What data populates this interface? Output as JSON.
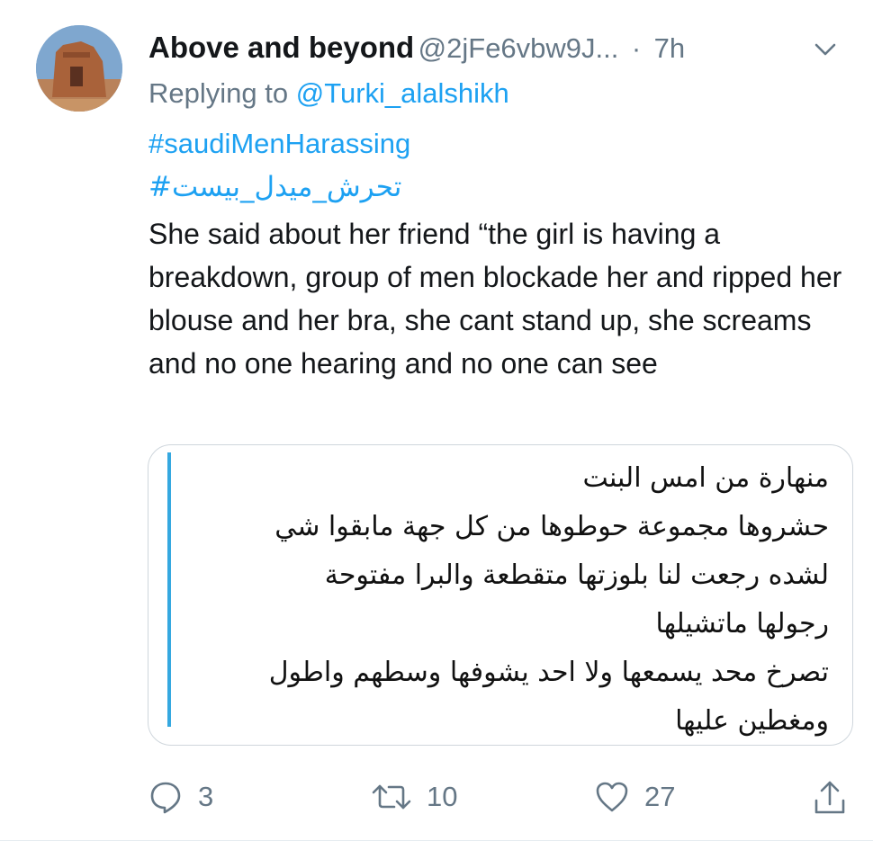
{
  "tweet": {
    "author_name": "Above and beyond",
    "author_handle": "@2jFe6vbw9J...",
    "separator": "·",
    "time": "7h",
    "replying_prefix": "Replying to",
    "replying_to": "@Turki_alalshikh",
    "hashtags": [
      "#saudiMenHarassing",
      "#تحرش_ميدل_بيست"
    ],
    "text": "She said about her friend “the girl is having a breakdown, group of men blockade her and ripped her blouse and her bra, she cant stand up, she screams and no one hearing and no one can see"
  },
  "quoted_image": {
    "lines": [
      "منهارة من امس البنت",
      "حشروها مجموعة حوطوها من كل جهة مابقوا شي",
      "لشده رجعت لنا بلوزتها متقطعة والبرا مفتوحة",
      "رجولها ماتشيلها",
      "تصرخ محد يسمعها ولا احد يشوفها وسطهم واطول",
      "ومغطين عليها"
    ]
  },
  "actions": {
    "reply_count": "3",
    "retweet_count": "10",
    "like_count": "27"
  },
  "icons": {
    "reply": "reply-icon",
    "retweet": "retweet-icon",
    "like": "heart-icon",
    "share": "share-icon",
    "menu": "chevron-down-icon"
  },
  "colors": {
    "link": "#1da1f2",
    "secondary_text": "#657786",
    "quote_accent": "#35a8e0"
  }
}
